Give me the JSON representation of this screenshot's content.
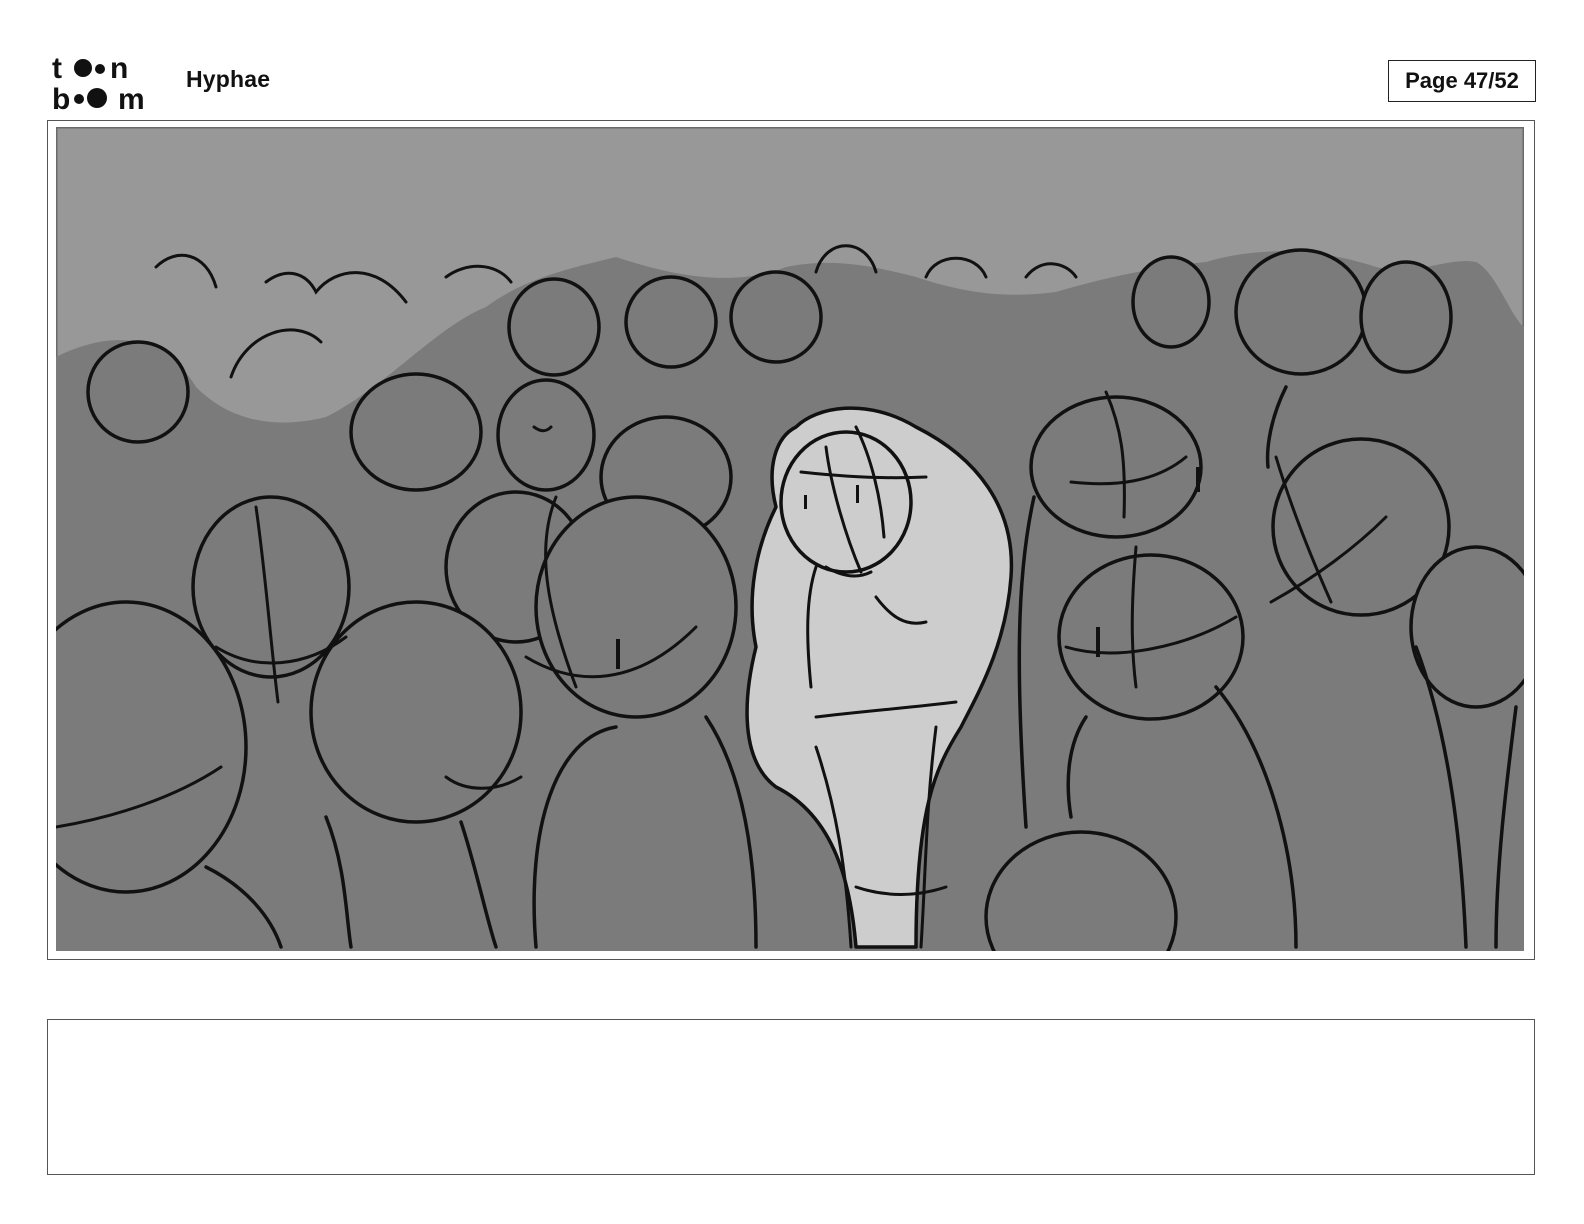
{
  "header": {
    "logo_text": "toon boom",
    "project_title": "Hyphae",
    "page_indicator": "Page 47/52"
  },
  "panel": {
    "colors": {
      "sky": "#989898",
      "crowd": "#7b7b7b",
      "girl": "#cdcdcd",
      "ink": "#111111"
    }
  },
  "caption": {
    "text": ""
  }
}
